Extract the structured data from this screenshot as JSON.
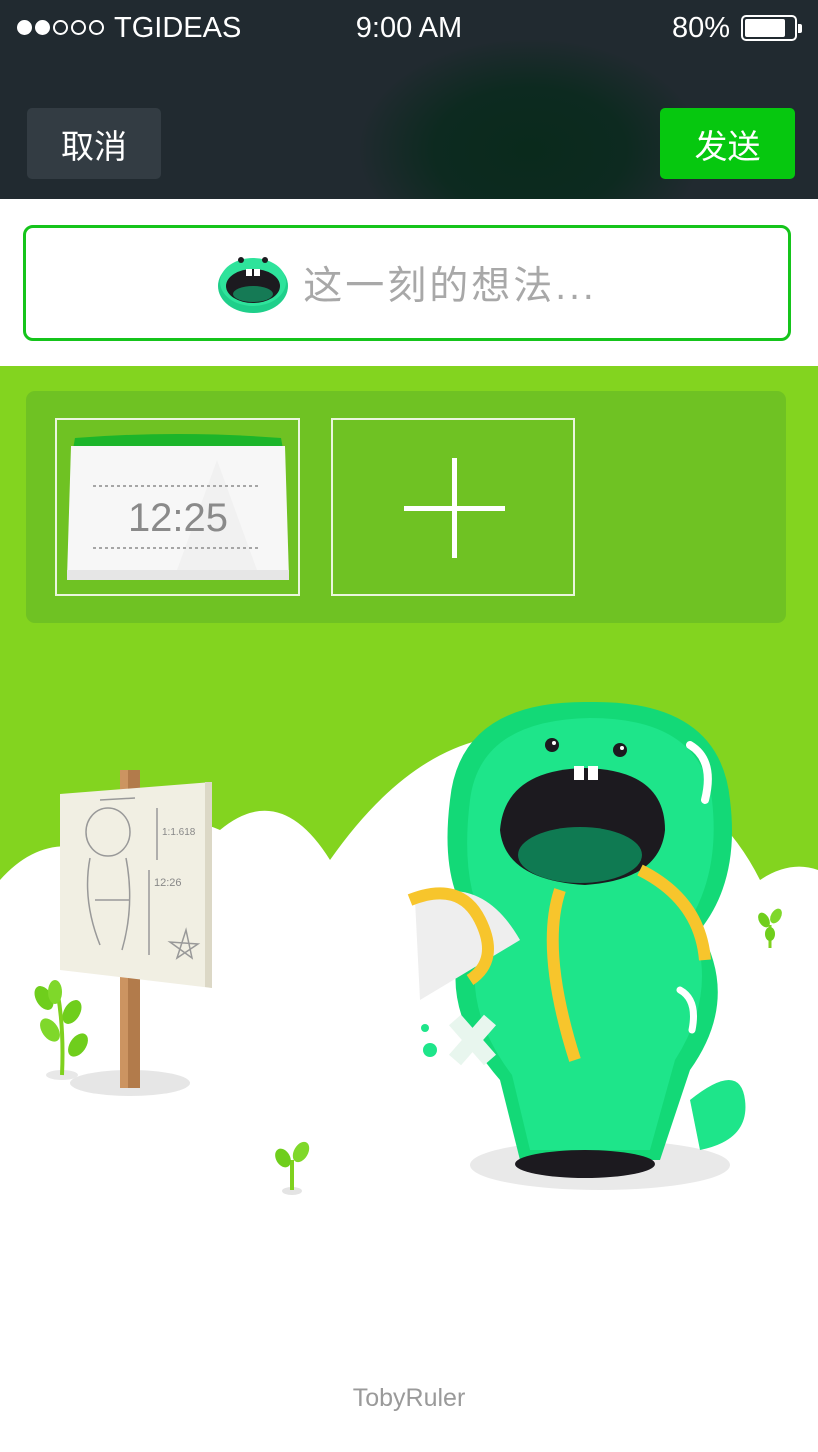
{
  "status_bar": {
    "carrier": "TGIDEAS",
    "time": "9:00 AM",
    "battery_percent": "80%",
    "signal_bars_filled": 2,
    "signal_bars_total": 5,
    "battery_level": 0.8
  },
  "header": {
    "cancel_label": "取消",
    "send_label": "发送",
    "send_color": "#06c80f"
  },
  "composer": {
    "placeholder": "这一刻的想法...",
    "border_color": "#15c41b",
    "icon": "monster-avatar-icon"
  },
  "attachments": {
    "photos": [
      {
        "icon": "clock-card-icon",
        "time_text": "12:25"
      }
    ],
    "add_icon": "plus-icon",
    "panel_color": "#83d41f"
  },
  "illustration": {
    "sign_text_1": "1:1.618",
    "sign_text_2": "12:26",
    "icons": [
      "drawing-board-icon",
      "monster-mascot-icon",
      "sprout-icon"
    ]
  },
  "footer": {
    "credit": "TobyRuler"
  }
}
